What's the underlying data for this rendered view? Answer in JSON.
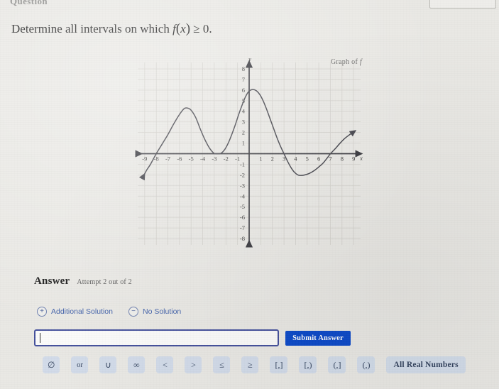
{
  "header": {
    "clipped_word": "Question",
    "top_right_box": "box-outline"
  },
  "question": {
    "text_before": "Determine all intervals on which",
    "function": "f",
    "open_paren": "(",
    "variable": "x",
    "close_paren": ")",
    "relation": "≥",
    "value": "0",
    "period": "."
  },
  "graph": {
    "label": "Graph of",
    "label_fn": "f",
    "x_axis_name": "x",
    "y_axis_name": "y",
    "x_ticks": [
      "-9",
      "-8",
      "-7",
      "-6",
      "-5",
      "-4",
      "-3",
      "-2",
      "-1",
      "1",
      "2",
      "3",
      "4",
      "5",
      "6",
      "7",
      "8",
      "9"
    ],
    "y_ticks": [
      "8",
      "7",
      "6",
      "5",
      "4",
      "3",
      "2",
      "1",
      "-1",
      "-2",
      "-3",
      "-4",
      "-5",
      "-6",
      "-7",
      "-8"
    ],
    "curve_color": "#3a3a42",
    "axis_color": "#2e2e34",
    "grid_color": "#c9c6c0"
  },
  "chart_data": {
    "type": "line",
    "title": "Graph of f",
    "xlabel": "x",
    "ylabel": "y",
    "xlim": [
      -9.6,
      9.6
    ],
    "ylim": [
      -8.6,
      8.6
    ],
    "grid": true,
    "legend": "none",
    "x_ticks": [
      -9,
      -8,
      -7,
      -6,
      -5,
      -4,
      -3,
      -2,
      -1,
      1,
      2,
      3,
      4,
      5,
      6,
      7,
      8,
      9
    ],
    "y_ticks": [
      8,
      7,
      6,
      5,
      4,
      3,
      2,
      1,
      -1,
      -2,
      -3,
      -4,
      -5,
      -6,
      -7,
      -8
    ],
    "series": [
      {
        "name": "f(x)",
        "points": [
          [
            -9.1,
            -2.1
          ],
          [
            -8.8,
            -1.5
          ],
          [
            -8.5,
            -1.0
          ],
          [
            -8.0,
            0.0
          ],
          [
            -7.5,
            0.9
          ],
          [
            -7.0,
            1.8
          ],
          [
            -6.5,
            2.8
          ],
          [
            -6.0,
            3.7
          ],
          [
            -5.6,
            4.25
          ],
          [
            -5.3,
            4.3
          ],
          [
            -5.0,
            4.1
          ],
          [
            -4.6,
            3.4
          ],
          [
            -4.2,
            2.3
          ],
          [
            -3.8,
            1.3
          ],
          [
            -3.4,
            0.5
          ],
          [
            -3.05,
            0.05
          ],
          [
            -2.9,
            0.0
          ],
          [
            -2.6,
            0.0
          ],
          [
            -2.4,
            0.05
          ],
          [
            -2.1,
            0.4
          ],
          [
            -1.8,
            1.0
          ],
          [
            -1.5,
            1.8
          ],
          [
            -1.2,
            2.7
          ],
          [
            -0.9,
            3.7
          ],
          [
            -0.6,
            4.6
          ],
          [
            -0.3,
            5.4
          ],
          [
            0.0,
            5.9
          ],
          [
            0.3,
            6.05
          ],
          [
            0.6,
            5.95
          ],
          [
            0.9,
            5.6
          ],
          [
            1.2,
            5.0
          ],
          [
            1.5,
            4.2
          ],
          [
            1.8,
            3.3
          ],
          [
            2.1,
            2.4
          ],
          [
            2.4,
            1.5
          ],
          [
            2.7,
            0.7
          ],
          [
            3.0,
            0.0
          ],
          [
            3.3,
            -0.7
          ],
          [
            3.6,
            -1.3
          ],
          [
            3.9,
            -1.75
          ],
          [
            4.2,
            -2.0
          ],
          [
            4.5,
            -2.05
          ],
          [
            4.8,
            -2.0
          ],
          [
            5.2,
            -1.85
          ],
          [
            5.6,
            -1.6
          ],
          [
            6.0,
            -1.25
          ],
          [
            6.4,
            -0.85
          ],
          [
            6.8,
            -0.3
          ],
          [
            7.0,
            0.0
          ],
          [
            7.4,
            0.45
          ],
          [
            7.8,
            0.95
          ],
          [
            8.2,
            1.4
          ],
          [
            8.6,
            1.75
          ],
          [
            9.0,
            2.05
          ]
        ],
        "arrow_start": [
          -9.1,
          -2.1
        ],
        "arrow_end": [
          9.0,
          2.05
        ]
      }
    ],
    "zeros": [
      -8,
      -2.75,
      3,
      7
    ],
    "local_max": [
      [
        -5.4,
        4.3
      ],
      [
        0.3,
        6.0
      ]
    ],
    "local_min": [
      [
        -2.75,
        0.0
      ],
      [
        4.5,
        -2.05
      ]
    ]
  },
  "answer": {
    "title": "Answer",
    "attempt": "Attempt 2 out of 2",
    "additional_solution": "Additional Solution",
    "additional_icon": "+",
    "no_solution": "No Solution",
    "no_solution_icon": "−",
    "input_value": "",
    "input_placeholder": "",
    "submit_label": "Submit Answer",
    "submit_color": "#0b49c8"
  },
  "keypad": {
    "keys": [
      {
        "label": "∅",
        "name": "empty-set"
      },
      {
        "label": "or",
        "name": "or"
      },
      {
        "label": "∪",
        "name": "union"
      },
      {
        "label": "∞",
        "name": "infinity"
      },
      {
        "label": "<",
        "name": "less-than"
      },
      {
        "label": ">",
        "name": "greater-than"
      },
      {
        "label": "≤",
        "name": "less-than-or-equal"
      },
      {
        "label": "≥",
        "name": "greater-than-or-equal"
      },
      {
        "label": "[,]",
        "name": "closed-interval"
      },
      {
        "label": "[,)",
        "name": "left-closed-interval"
      },
      {
        "label": "(,]",
        "name": "right-closed-interval"
      },
      {
        "label": "(,)",
        "name": "open-interval"
      },
      {
        "label": "All Real Numbers",
        "name": "all-real-numbers"
      }
    ]
  }
}
